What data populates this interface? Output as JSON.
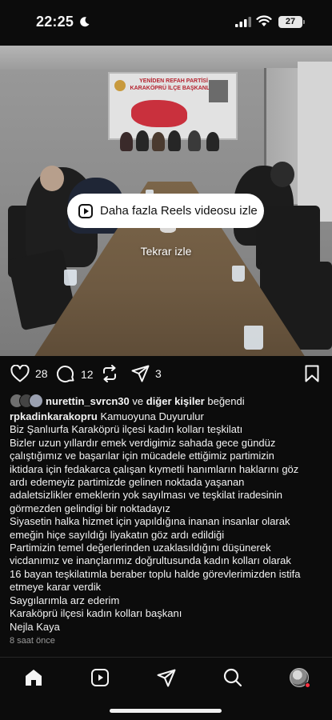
{
  "status_bar": {
    "time": "22:25",
    "battery": "27"
  },
  "media": {
    "banner_title": "YENİDEN REFAH PARTİSİ KARAKÖPRÜ İLÇE BAŞKANLIĞI",
    "reels_button_label": "Daha fazla Reels videosu izle",
    "replay_label": "Tekrar izle"
  },
  "actions": {
    "likes": "28",
    "comments": "12",
    "shares": "3"
  },
  "liked_by": {
    "user": "nurettin_svrcn30",
    "connector": "ve",
    "others": "diğer kişiler",
    "suffix": "beğendi"
  },
  "caption": {
    "username": "rpkadinkarakopru",
    "first": "Kamuoyuna Duyurulur",
    "lines": [
      "Biz Şanlıurfa Karaköprü ilçesi kadın kolları teşkilatı",
      "Bizler uzun yıllardır emek verdigimiz sahada gece gündüz",
      "çalıştığımız ve başarılar için mücadele ettiğimiz partimizin",
      "iktidara için fedakarca çalışan  kıymetli hanımların haklarını göz",
      "ardı edemeyiz partimizde gelinen noktada yaşanan",
      "adaletsizlikler emeklerin yok sayılması ve teşkilat iradesinin",
      "görmezden  gelindigi bir noktadayız",
      "Siyasetin halka hizmet için yapıldığına inanan insanlar olarak",
      "emeğin hiçe sayıldığı liyakatın göz ardı edildiği",
      "Partimizin temel değerlerinden uzaklasıldığını düşünerek",
      "vicdanımız ve inançlarımız doğrultusunda kadın kolları  olarak",
      "16 bayan teşkilatımla beraber toplu halde görevlerimizden istifa",
      "etmeye karar verdik",
      "Saygılarımla arz ederim",
      "Karaköprü ilçesi kadın kolları başkanı",
      "Nejla Kaya"
    ]
  },
  "timestamp": "8 saat önce",
  "icons": {
    "like": "heart-icon",
    "comment": "comment-icon",
    "share_repost": "repost-icon",
    "send": "send-icon",
    "save": "bookmark-icon",
    "nav": [
      "home-icon",
      "reels-icon",
      "send-icon",
      "search-icon",
      "profile-avatar"
    ]
  },
  "colors": {
    "background": "#0c0c0c",
    "text": "#f5f5f5",
    "muted": "#9a9a9a",
    "notification": "#ff3040"
  }
}
